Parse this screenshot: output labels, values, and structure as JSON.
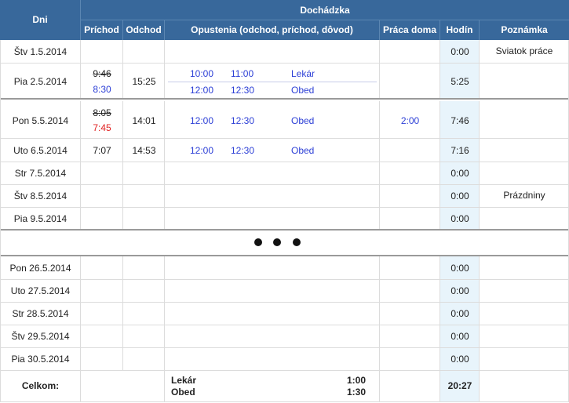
{
  "header": {
    "dni": "Dni",
    "dochadzka": "Dochádzka",
    "prichod": "Príchod",
    "odchod": "Odchod",
    "opustenia": "Opustenia (odchod, príchod, dôvod)",
    "praca_doma": "Práca doma",
    "hodin": "Hodín",
    "poznamka": "Poznámka"
  },
  "rows": [
    {
      "day": "Štv 1.5.2014",
      "prichod": "",
      "prichod_fix": "",
      "odchod": "",
      "leaves": [],
      "praca_doma": "",
      "hodin": "0:00",
      "poznamka": "Sviatok práce"
    },
    {
      "day": "Pia 2.5.2014",
      "prichod": "9:46",
      "prichod_fix": "8:30",
      "odchod": "15:25",
      "leaves": [
        {
          "from": "10:00",
          "to": "11:00",
          "reason": "Lekár"
        },
        {
          "from": "12:00",
          "to": "12:30",
          "reason": "Obed"
        }
      ],
      "praca_doma": "",
      "hodin": "5:25",
      "poznamka": ""
    },
    {
      "day": "Pon 5.5.2014",
      "prichod": "8:05",
      "prichod_fix": "7:45",
      "odchod": "14:01",
      "leaves": [
        {
          "from": "12:00",
          "to": "12:30",
          "reason": "Obed"
        }
      ],
      "praca_doma": "2:00",
      "hodin": "7:46",
      "poznamka": ""
    },
    {
      "day": "Uto 6.5.2014",
      "prichod": "7:07",
      "prichod_fix": "",
      "odchod": "14:53",
      "leaves": [
        {
          "from": "12:00",
          "to": "12:30",
          "reason": "Obed"
        }
      ],
      "praca_doma": "",
      "hodin": "7:16",
      "poznamka": ""
    },
    {
      "day": "Str 7.5.2014",
      "hodin": "0:00",
      "poznamka": ""
    },
    {
      "day": "Štv 8.5.2014",
      "hodin": "0:00",
      "poznamka": "Prázdniny"
    },
    {
      "day": "Pia 9.5.2014",
      "hodin": "0:00",
      "poznamka": ""
    },
    {
      "day": "Pon 26.5.2014",
      "hodin": "0:00",
      "poznamka": ""
    },
    {
      "day": "Uto 27.5.2014",
      "hodin": "0:00",
      "poznamka": ""
    },
    {
      "day": "Str 28.5.2014",
      "hodin": "0:00",
      "poznamka": ""
    },
    {
      "day": "Štv 29.5.2014",
      "hodin": "0:00",
      "poznamka": ""
    },
    {
      "day": "Pia 30.5.2014",
      "hodin": "0:00",
      "poznamka": ""
    }
  ],
  "summary": {
    "label": "Celkom:",
    "items": [
      {
        "reason": "Lekár",
        "total": "1:00"
      },
      {
        "reason": "Obed",
        "total": "1:30"
      }
    ],
    "hodin": "20:27"
  },
  "colors": {
    "header_bg": "#38689b",
    "hours_col_bg": "#e8f4fb",
    "time_blue": "#2c3fd6",
    "corrected_red": "#e02020"
  }
}
